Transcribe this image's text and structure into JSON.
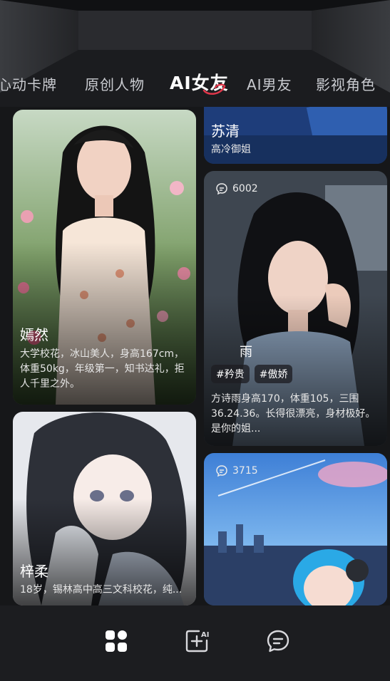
{
  "tabs": [
    {
      "label": "心动卡牌",
      "active": false
    },
    {
      "label": "原创人物",
      "active": false
    },
    {
      "label": "AI女友",
      "active": true
    },
    {
      "label": "AI男友",
      "active": false
    },
    {
      "label": "影视角色",
      "active": false
    }
  ],
  "cards": {
    "yanran": {
      "name": "嫣然",
      "desc": "大学校花，冰山美人，身高167cm，体重50kg，年级第一，知书达礼，拒人千里之外。"
    },
    "suqing": {
      "name": "苏清",
      "desc": "高冷御姐"
    },
    "fang": {
      "count": "6002",
      "name": "雨",
      "tags": [
        "#矜贵",
        "#傲娇"
      ],
      "desc": "方诗雨身高170，体重105，三围36.24.36。长得很漂亮，身材极好。是你的姐..."
    },
    "zirou": {
      "name": "梓柔",
      "desc": "18岁，锡林高中高三文科校花，纯..."
    },
    "anime": {
      "count": "3715"
    }
  },
  "nav": {
    "items": [
      {
        "icon": "discover-grid-icon"
      },
      {
        "icon": "create-ai-icon"
      },
      {
        "icon": "chat-icon"
      }
    ]
  }
}
